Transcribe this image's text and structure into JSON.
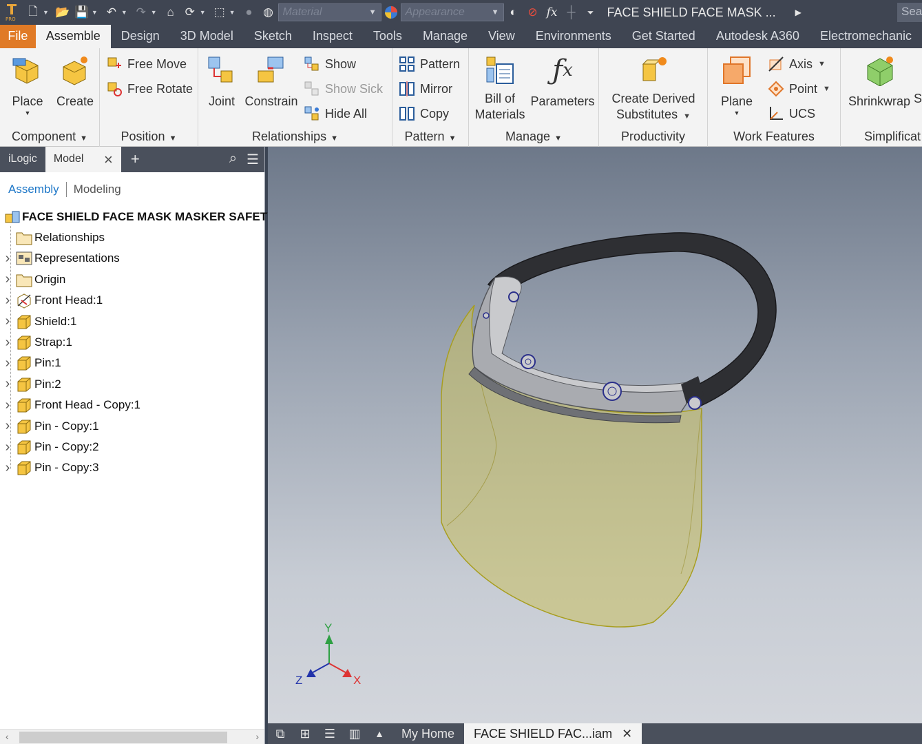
{
  "qat": {
    "material_placeholder": "Material",
    "appearance_placeholder": "Appearance",
    "fx_label": "fx",
    "title": "FACE SHIELD FACE MASK ...",
    "search_text": "Sea"
  },
  "tabs": [
    "File",
    "Assemble",
    "Design",
    "3D Model",
    "Sketch",
    "Inspect",
    "Tools",
    "Manage",
    "View",
    "Environments",
    "Get Started",
    "Autodesk A360",
    "Electromechanic"
  ],
  "active_tab": "Assemble",
  "ribbon": {
    "component": {
      "label": "Component",
      "place": "Place",
      "create": "Create"
    },
    "position": {
      "label": "Position",
      "free_move": "Free Move",
      "free_rotate": "Free Rotate"
    },
    "relationships": {
      "label": "Relationships",
      "joint": "Joint",
      "constrain": "Constrain",
      "show": "Show",
      "show_sick": "Show Sick",
      "hide_all": "Hide All"
    },
    "pattern": {
      "label": "Pattern",
      "pattern": "Pattern",
      "mirror": "Mirror",
      "copy": "Copy"
    },
    "manage": {
      "label": "Manage",
      "bom_line1": "Bill of",
      "bom_line2": "Materials",
      "parameters": "Parameters"
    },
    "productivity": {
      "label": "Productivity",
      "cds_line1": "Create Derived",
      "cds_line2": "Substitutes"
    },
    "work_features": {
      "label": "Work Features",
      "plane": "Plane",
      "axis": "Axis",
      "point": "Point",
      "ucs": "UCS"
    },
    "simplification": {
      "label": "Simplificat",
      "shrinkwrap": "Shrinkwrap",
      "extra": "S"
    }
  },
  "browser": {
    "tab_ilogic": "iLogic",
    "tab_model": "Model",
    "mode_assembly": "Assembly",
    "mode_modeling": "Modeling",
    "root": "FACE SHIELD FACE MASK MASKER SAFETY.",
    "items": [
      {
        "label": "Relationships",
        "icon": "folder-icon",
        "expand": false
      },
      {
        "label": "Representations",
        "icon": "representations-icon",
        "expand": true
      },
      {
        "label": "Origin",
        "icon": "folder-icon",
        "expand": true
      },
      {
        "label": "Front Head:1",
        "icon": "grounded-part-icon",
        "expand": true
      },
      {
        "label": "Shield:1",
        "icon": "part-icon",
        "expand": true
      },
      {
        "label": "Strap:1",
        "icon": "part-icon",
        "expand": true
      },
      {
        "label": "Pin:1",
        "icon": "part-icon",
        "expand": true
      },
      {
        "label": "Pin:2",
        "icon": "part-icon",
        "expand": true
      },
      {
        "label": "Front Head - Copy:1",
        "icon": "part-icon",
        "expand": true
      },
      {
        "label": "Pin - Copy:1",
        "icon": "part-icon",
        "expand": true
      },
      {
        "label": "Pin - Copy:2",
        "icon": "part-icon",
        "expand": true
      },
      {
        "label": "Pin - Copy:3",
        "icon": "part-icon",
        "expand": true
      }
    ]
  },
  "triad": {
    "x": "X",
    "y": "Y",
    "z": "Z"
  },
  "doc_tabs": {
    "home": "My Home",
    "active_doc": "FACE SHIELD FAC...iam"
  },
  "colors": {
    "file_tab": "#e07a26",
    "selection_blue": "#1f78c8",
    "shield_yellow": "#c8c060"
  }
}
